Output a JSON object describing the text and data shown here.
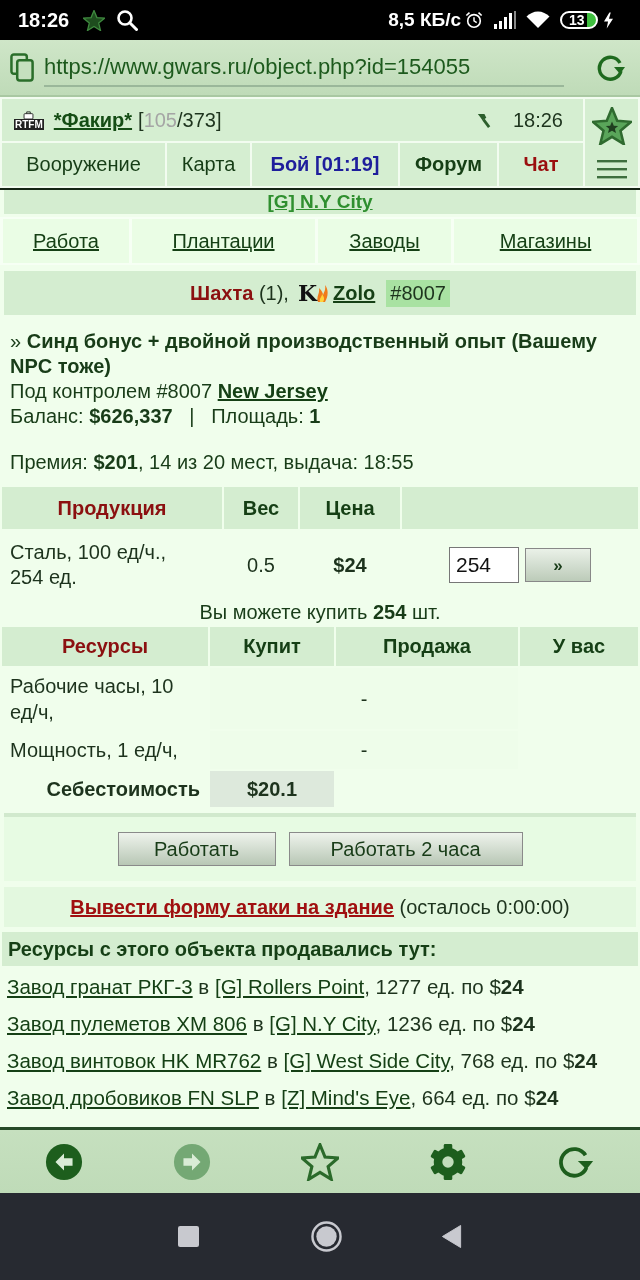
{
  "status_bar": {
    "time": "18:26",
    "network_speed": "8,5 КБ/с",
    "battery": "13"
  },
  "browser": {
    "url": "https://www.gwars.ru/object.php?id=154055"
  },
  "game_header": {
    "clan_tag": "RTFM",
    "player": "*Факир*",
    "hp_open": "[",
    "hp_current": "105",
    "hp_rest": "/373]",
    "time": "18:26"
  },
  "tabs": [
    {
      "label": "Вооружение",
      "kind": "plain"
    },
    {
      "label": "Карта",
      "kind": "plain"
    },
    {
      "label": "Бой [01:19]",
      "kind": "battle"
    },
    {
      "label": "Форум",
      "kind": "forum"
    },
    {
      "label": "Чат",
      "kind": "chat"
    }
  ],
  "city": "[G] N.Y City",
  "nav_links": [
    "Работа",
    "Плантации",
    "Заводы",
    "Магазины"
  ],
  "object": {
    "type": "Шахта",
    "count": "(1),",
    "logo_letter": "K",
    "owner": "Zolo",
    "owner_id": "#8007"
  },
  "info": {
    "bonus": "» **Синд бонус + двойной производственный опыт (Вашему NPC тоже)**",
    "control_text": "Под контролем #8007",
    "control_link": "New Jersey",
    "balance": "Баланс: **$626,337**   |   Площадь: **1**",
    "premium": "Премия: **$201**, 14 из 20 мест, выдача: 18:55"
  },
  "production": {
    "columns": [
      "Продукция",
      "Вес",
      "Цена"
    ],
    "rows": [
      {
        "name": "Сталь, 100 ед/ч., 254 ед.",
        "weight": "0.5",
        "price": "$24",
        "quantity": "254",
        "action": "»"
      }
    ],
    "note": "Вы можете купить **254** шт."
  },
  "resources": {
    "columns": [
      "Ресурсы",
      "Купит",
      "Продажа",
      "У вас"
    ],
    "rows": [
      {
        "name": "Рабочие часы, 10 ед/ч,",
        "value": "-"
      },
      {
        "name": "Мощность, 1 ед/ч,",
        "value": "-"
      }
    ],
    "cost_label": "Себестоимость",
    "cost_value": "$20.1"
  },
  "actions": [
    "Работать",
    "Работать 2 часа"
  ],
  "attack": {
    "link": "Вывести форму атаки на здание",
    "remaining": "(осталось 0:00:00)"
  },
  "sales": {
    "title": "Ресурсы с этого объекта продавались тут:",
    "items": [
      {
        "factory": "Завод гранат РКГ-3",
        "preposition": "в",
        "city": "[G] Rollers Point",
        "details": ", 1277 ед. по $**24**"
      },
      {
        "factory": "Завод пулеметов XM 806",
        "preposition": "в",
        "city": "[G] N.Y City",
        "details": ", 1236 ед. по $**24**"
      },
      {
        "factory": "Завод винтовок HK MR762",
        "preposition": "в",
        "city": "[G] West Side City",
        "details": ", 768 ед. по $**24**"
      },
      {
        "factory": "Завод дробовиков FN SLP",
        "preposition": "в",
        "city": "[Z] Mind's Eye",
        "details": ", 664 ед. по $**24**"
      }
    ]
  },
  "browser_toolbar": {
    "back_disabled": false,
    "forward_disabled": true
  }
}
